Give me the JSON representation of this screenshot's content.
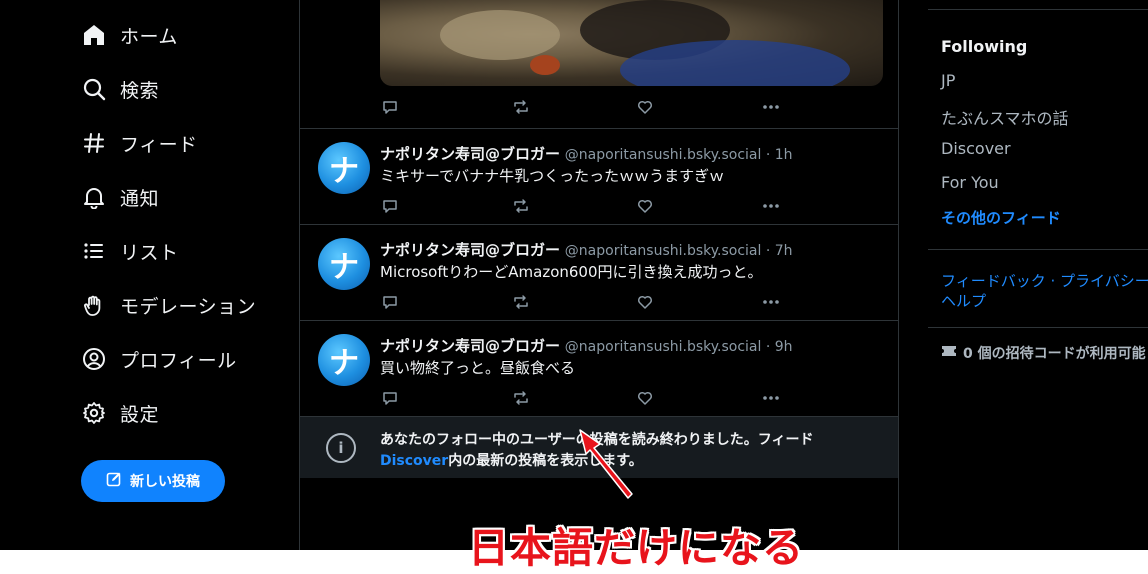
{
  "nav": {
    "items": [
      {
        "label": "ホーム",
        "icon": "home-icon"
      },
      {
        "label": "検索",
        "icon": "search-icon"
      },
      {
        "label": "フィード",
        "icon": "hashtag-icon"
      },
      {
        "label": "通知",
        "icon": "bell-icon"
      },
      {
        "label": "リスト",
        "icon": "list-icon"
      },
      {
        "label": "モデレーション",
        "icon": "hand-icon"
      },
      {
        "label": "プロフィール",
        "icon": "user-icon"
      },
      {
        "label": "設定",
        "icon": "gear-icon"
      }
    ],
    "new_post_label": "新しい投稿"
  },
  "posts": [
    {
      "name": "ナポリタン寿司@ブロガー",
      "handle": "@naporitansushi.bsky.social",
      "time": "1h",
      "text": "ミキサーでバナナ牛乳つくったったｗｗうますぎｗ"
    },
    {
      "name": "ナポリタン寿司@ブロガー",
      "handle": "@naporitansushi.bsky.social",
      "time": "7h",
      "text": "MicrosoftりわーどAmazon600円に引き換え成功っと。"
    },
    {
      "name": "ナポリタン寿司@ブロガー",
      "handle": "@naporitansushi.bsky.social",
      "time": "9h",
      "text": "買い物終了っと。昼飯食べる"
    }
  ],
  "avatar_glyph": "ナ",
  "meta_separator": " · ",
  "notice": {
    "line1": "あなたのフォロー中のユーザーの投稿を読み終わりました。フィード",
    "link": "Discover",
    "line2": "内の最新の投稿を表示します。"
  },
  "right": {
    "feeds_title": "Following",
    "feeds": [
      "JP",
      "たぶんスマホの話",
      "Discover",
      "For You"
    ],
    "more_feeds": "その他のフィード",
    "footer_feedback": "フィードバック",
    "footer_privacy": "プライバシー",
    "footer_help": "ヘルプ",
    "footer_sep": " · ",
    "invite_text": "0 個の招待コードが利用可能"
  },
  "annotation": "日本語だけになる",
  "colors": {
    "background": "#000000",
    "accent": "#208bfe",
    "button": "#1083fe",
    "annotation": "#e8141c"
  }
}
